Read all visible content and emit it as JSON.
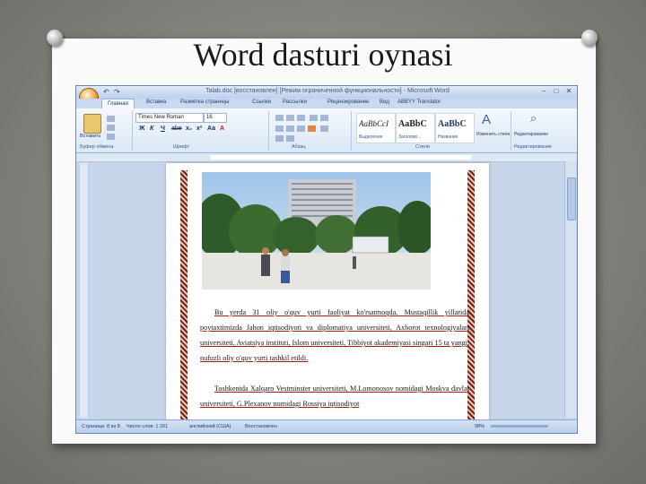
{
  "slide": {
    "title": "Word dasturi oynasi"
  },
  "window": {
    "title": "Talab.doc [восстановлен] [Режим ограниченной функциональности] - Microsoft Word",
    "quick_access": [
      "↶",
      "↷"
    ],
    "controls": [
      "–",
      "□",
      "✕"
    ]
  },
  "tabs": [
    "Главная",
    "Вставка",
    "Разметка страницы",
    "Ссылки",
    "Рассылки",
    "Рецензирование",
    "Вид",
    "ABBYY Translator"
  ],
  "ribbon": {
    "groups": [
      "Буфер обмена",
      "Шрифт",
      "Абзац",
      "Стили",
      "Редактирование"
    ],
    "paste_label": "Вставить",
    "font_name": "Times New Roman",
    "font_size": "16",
    "format_buttons": [
      "Ж",
      "К",
      "Ч",
      "abe",
      "x₂",
      "x²",
      "Аа",
      "A"
    ],
    "styles": [
      {
        "sample": "AaBbCcI",
        "name": "Выделение"
      },
      {
        "sample": "AaBbC",
        "name": "Заголово..."
      },
      {
        "sample": "AaBbC",
        "name": "Название"
      }
    ],
    "change_styles_label": "Изменить стили",
    "editing_label": "Редактирование"
  },
  "document": {
    "paragraphs": [
      "Bu yerda 31 oliy o'quv yurti faoliyat ko'rsatmoqda. Mustaqillik yillarida poytaxtimizda Jahon iqtisodiyoti va diplomatiya universiteti, Axborot texnologiyalari universiteti, Aviatsiya instituti, Islom universiteti, Tibbiyot akademiyasi singari 15 ta yangi, nufuzli oliy o'quv yurti tashkil etildi.",
      "Toshkentda Xalqaro Vestminster universiteti, M.Lomonosov nomidagi Moskva davlat universiteti, G.Plexanov nomidagi Rossiya iqtisodiyot"
    ]
  },
  "status_bar": {
    "page": "Страница: 8 из 8",
    "words": "Число слов: 1 201",
    "language": "английский (США)",
    "mode": "Восстановлен",
    "zoom": "98%"
  },
  "colors": {
    "ribbon_bg": "#dbe7f6",
    "frame_bg": "#c6d5ea",
    "page_border": "#7a1f18"
  }
}
